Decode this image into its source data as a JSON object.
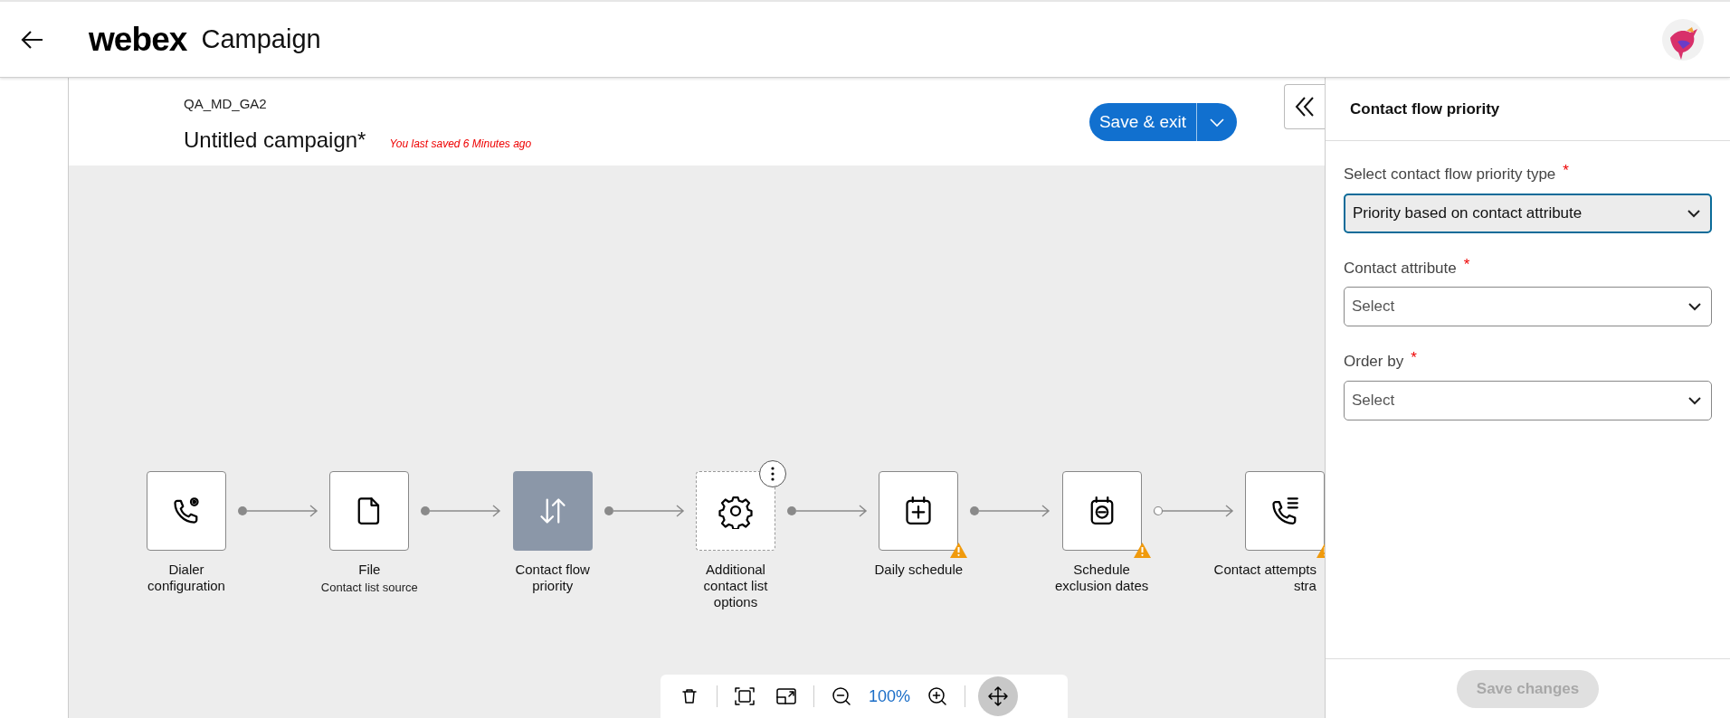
{
  "header": {
    "brand": "webex",
    "title": "Campaign"
  },
  "campaign": {
    "tenant": "QA_MD_GA2",
    "name": "Untitled campaign*",
    "saved_note": "You last saved 6 Minutes ago",
    "save_button": "Save & exit"
  },
  "flow": {
    "nodes": [
      {
        "label": "Dialer configuration",
        "selected": false,
        "focused": false,
        "warning": false,
        "link_filled": true
      },
      {
        "label": "File",
        "sublabel": "Contact list source",
        "selected": false,
        "focused": false,
        "warning": false,
        "link_filled": true
      },
      {
        "label": "Contact flow priority",
        "selected": true,
        "focused": false,
        "warning": false,
        "link_filled": true
      },
      {
        "label": "Additional contact list options",
        "selected": false,
        "focused": true,
        "warning": false,
        "link_filled": true
      },
      {
        "label": "Daily schedule",
        "selected": false,
        "focused": false,
        "warning": true,
        "link_filled": true
      },
      {
        "label": "Schedule exclusion dates",
        "selected": false,
        "focused": false,
        "warning": true,
        "link_filled": false
      },
      {
        "label": "Contact attempts stra",
        "selected": false,
        "focused": false,
        "warning": true
      }
    ]
  },
  "toolbar": {
    "zoom": "100%",
    "pan_mode": true
  },
  "panel": {
    "title": "Contact flow priority",
    "fields": [
      {
        "label": "Select contact flow priority type",
        "required_mark": "*",
        "value": "Priority based on contact attribute",
        "focused": true
      },
      {
        "label": "Contact attribute",
        "required_mark": "*",
        "placeholder": "Select",
        "focused": false
      },
      {
        "label": "Order by",
        "required_mark": "*",
        "placeholder": "Select",
        "focused": false
      }
    ],
    "save_button": {
      "label": "Save changes",
      "disabled": true
    }
  }
}
